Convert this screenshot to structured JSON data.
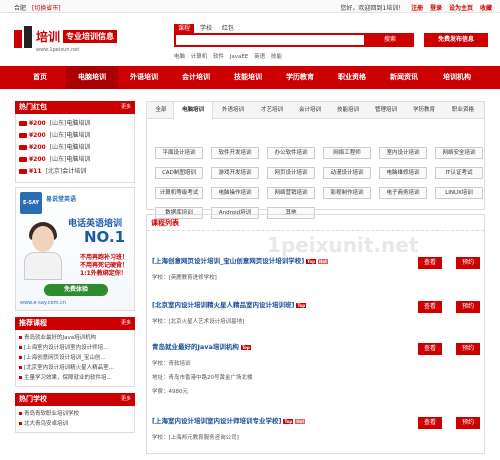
{
  "topbar": {
    "city": "合肥",
    "switch": "[切换省市]",
    "greeting": "您好，欢迎回到1培训！",
    "links": [
      "注册",
      "登录",
      "设为主页",
      "收藏"
    ]
  },
  "header": {
    "logo_name": "培训",
    "logo_tagline": "专业培训信息",
    "logo_url": "www.1peixun.net",
    "search_tabs": [
      "课程",
      "学校",
      "红包"
    ],
    "search_active_tab": "课程",
    "search_button": "搜索",
    "hot_words": [
      "电脑",
      "计算机",
      "软件",
      "JavaEE",
      "英语",
      "技能"
    ],
    "publish_button": "免费发布信息"
  },
  "nav": {
    "items": [
      "首页",
      "电脑培训",
      "外语培训",
      "会计培训",
      "技能培训",
      "学历教育",
      "职业资格",
      "新闻资讯",
      "培训机构"
    ],
    "active": "电脑培训"
  },
  "hotbag": {
    "title": "热门红包",
    "more": "更多",
    "rows": [
      {
        "price": "¥200",
        "org": "[山东]",
        "name": "电脑培训"
      },
      {
        "price": "¥200",
        "org": "[山东]",
        "name": "电脑培训"
      },
      {
        "price": "¥200",
        "org": "[山东]",
        "name": "电脑培训"
      },
      {
        "price": "¥200",
        "org": "[山东]",
        "name": "电脑培训"
      },
      {
        "price": "¥11",
        "org": "[北京]",
        "name": "会计培训"
      }
    ]
  },
  "ad": {
    "brand_logo": "E-SAY",
    "brand_text": "易说堂英语",
    "line1": "电话英语培训",
    "line2": "NO.1",
    "line3": "不用再跑补习班！",
    "line4": "不用再死记硬背！",
    "line5": "1:1外教绑定你！",
    "trial_button": "免费体验",
    "site": "www.e-say.com.cn"
  },
  "recommend": {
    "title": "推荐课程",
    "more": "更多",
    "items": [
      "青岛就业最好的Java培训机构",
      "[上海室内设计培训室内设计师培...",
      "[上海创意网页设计培训_宝山创...",
      "[北京室内设计培训精火星人精品室...",
      "主量学习效果，保障就业的软件培..."
    ]
  },
  "hotschool": {
    "title": "热门学校",
    "more": "更多",
    "items": [
      "青岛青软职业培训学校",
      "北大青鸟安卓培训"
    ]
  },
  "categories": {
    "tabs": [
      "全部",
      "电脑培训",
      "外语培训",
      "才艺培训",
      "会计培训",
      "技能培训",
      "管理培训",
      "学历教育",
      "职业资格"
    ],
    "active": "电脑培训",
    "cells": [
      [
        "平面设计培训",
        "软件开发培训",
        "办公软件培训",
        "网络工程师",
        "室内设计培训",
        "网络安全培训"
      ],
      [
        "CAD制图培训",
        "游戏开发培训",
        "网页设计培训",
        "动漫设计培训",
        "电脑维修培训",
        "IT认证考试"
      ],
      [
        "计算机等级考试",
        "电脑操作培训",
        "网络营销培训",
        "影视制作培训",
        "电子商务培训",
        "LINUX培训"
      ],
      [
        "数据库培训",
        "Android培训",
        "其他"
      ]
    ]
  },
  "courses": {
    "title": "课程列表",
    "watermark": "1peixunit.net",
    "view_label": "查看",
    "book_label": "预约",
    "items": [
      {
        "title": "[上海创意网页设计培训_宝山创意网页设计培训学校]",
        "badges": [
          "Top",
          "Hot"
        ],
        "school_label": "学校：",
        "school": "[英鹿教育进修学校]"
      },
      {
        "title": "[北京室内设计培训精火星人精品室内设计培训班]",
        "badges": [
          "Top"
        ],
        "school_label": "学校：",
        "school": "[北京火星人艺术设计培训基地]"
      },
      {
        "title": "青岛就业最好的Java培训机构",
        "badges": [
          "Top"
        ],
        "school_label": "学校：",
        "school": "青软培训",
        "addr_label": "地址：",
        "addr": "青岛市香港中路20号黄金广场北楼",
        "fee_label": "学费：",
        "fee": "4980元"
      },
      {
        "title": "[上海室内设计培训室内设计师培训专业学校]",
        "badges": [
          "Top",
          "Hot"
        ],
        "school_label": "学校：",
        "school": "[上海邦元教育服务咨询公司]"
      }
    ]
  },
  "colors": {
    "brand": "#cc0000",
    "link": "#1a4f99"
  }
}
